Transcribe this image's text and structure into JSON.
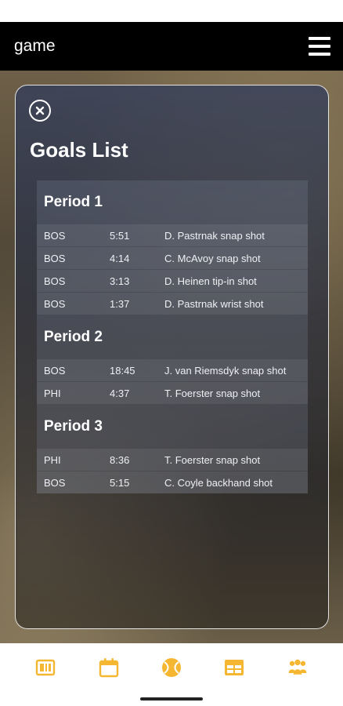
{
  "app_bar": {
    "title": "game",
    "menu_icon": "hamburger-menu-icon"
  },
  "modal": {
    "close_icon": "close-circle-icon",
    "title": "Goals List",
    "periods": [
      {
        "title": "Period 1",
        "goals": [
          {
            "team": "BOS",
            "time": "5:51",
            "description": "D. Pastrnak snap shot"
          },
          {
            "team": "BOS",
            "time": "4:14",
            "description": "C. McAvoy snap shot"
          },
          {
            "team": "BOS",
            "time": "3:13",
            "description": "D. Heinen tip-in shot"
          },
          {
            "team": "BOS",
            "time": "1:37",
            "description": "D. Pastrnak wrist shot"
          }
        ]
      },
      {
        "title": "Period 2",
        "goals": [
          {
            "team": "BOS",
            "time": "18:45",
            "description": "J. van Riemsdyk snap shot"
          },
          {
            "team": "PHI",
            "time": "4:37",
            "description": "T. Foerster snap shot"
          }
        ]
      },
      {
        "title": "Period 3",
        "goals": [
          {
            "team": "PHI",
            "time": "8:36",
            "description": "T. Foerster snap shot"
          },
          {
            "team": "BOS",
            "time": "5:15",
            "description": "C. Coyle backhand shot"
          }
        ]
      }
    ]
  },
  "bottom_nav": {
    "accent_color": "#f5b731",
    "items": [
      "scoreboard-icon",
      "calendar-icon",
      "ball-icon",
      "table-icon",
      "team-icon"
    ]
  }
}
